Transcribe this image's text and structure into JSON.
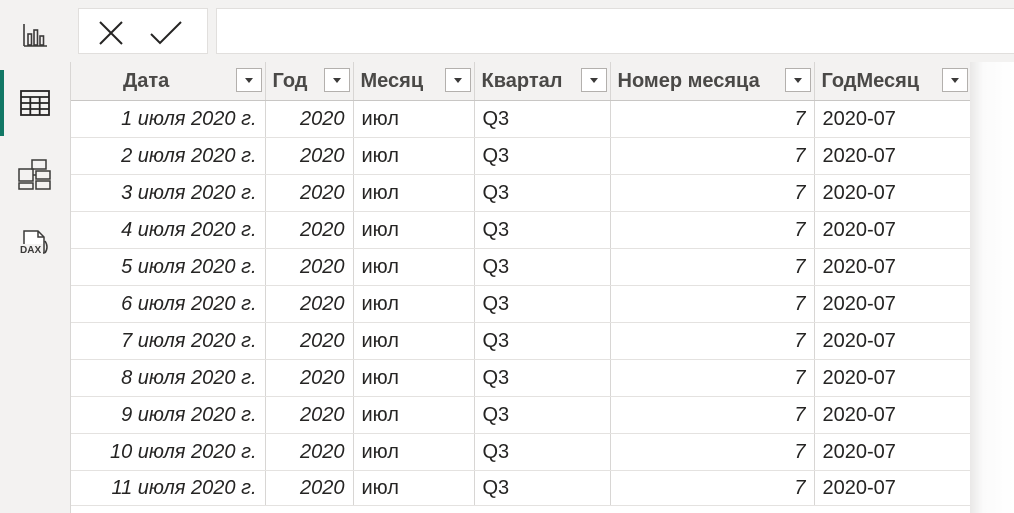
{
  "nav": {
    "items": [
      {
        "name": "report-view",
        "icon": "bar-chart-icon",
        "active": false
      },
      {
        "name": "data-view",
        "icon": "table-icon",
        "active": true
      },
      {
        "name": "model-view",
        "icon": "model-icon",
        "active": false
      },
      {
        "name": "dax-query-view",
        "icon": "dax-icon",
        "active": false,
        "icon_text": "DAX"
      }
    ]
  },
  "formula_bar": {
    "cancel_icon": "close-icon",
    "commit_icon": "check-icon",
    "formula": ""
  },
  "table": {
    "columns": [
      "Дата",
      "Год",
      "Месяц",
      "Квартал",
      "Номер месяца",
      "ГодМесяц"
    ],
    "rows": [
      [
        "1 июля 2020 г.",
        "2020",
        "июл",
        "Q3",
        "7",
        "2020-07"
      ],
      [
        "2 июля 2020 г.",
        "2020",
        "июл",
        "Q3",
        "7",
        "2020-07"
      ],
      [
        "3 июля 2020 г.",
        "2020",
        "июл",
        "Q3",
        "7",
        "2020-07"
      ],
      [
        "4 июля 2020 г.",
        "2020",
        "июл",
        "Q3",
        "7",
        "2020-07"
      ],
      [
        "5 июля 2020 г.",
        "2020",
        "июл",
        "Q3",
        "7",
        "2020-07"
      ],
      [
        "6 июля 2020 г.",
        "2020",
        "июл",
        "Q3",
        "7",
        "2020-07"
      ],
      [
        "7 июля 2020 г.",
        "2020",
        "июл",
        "Q3",
        "7",
        "2020-07"
      ],
      [
        "8 июля 2020 г.",
        "2020",
        "июл",
        "Q3",
        "7",
        "2020-07"
      ],
      [
        "9 июля 2020 г.",
        "2020",
        "июл",
        "Q3",
        "7",
        "2020-07"
      ],
      [
        "10 июля 2020 г.",
        "2020",
        "июл",
        "Q3",
        "7",
        "2020-07"
      ],
      [
        "11 июля 2020 г.",
        "2020",
        "июл",
        "Q3",
        "7",
        "2020-07"
      ]
    ]
  },
  "colors": {
    "accent": "#117865",
    "chrome": "#f3f2f1",
    "text": "#252423"
  }
}
